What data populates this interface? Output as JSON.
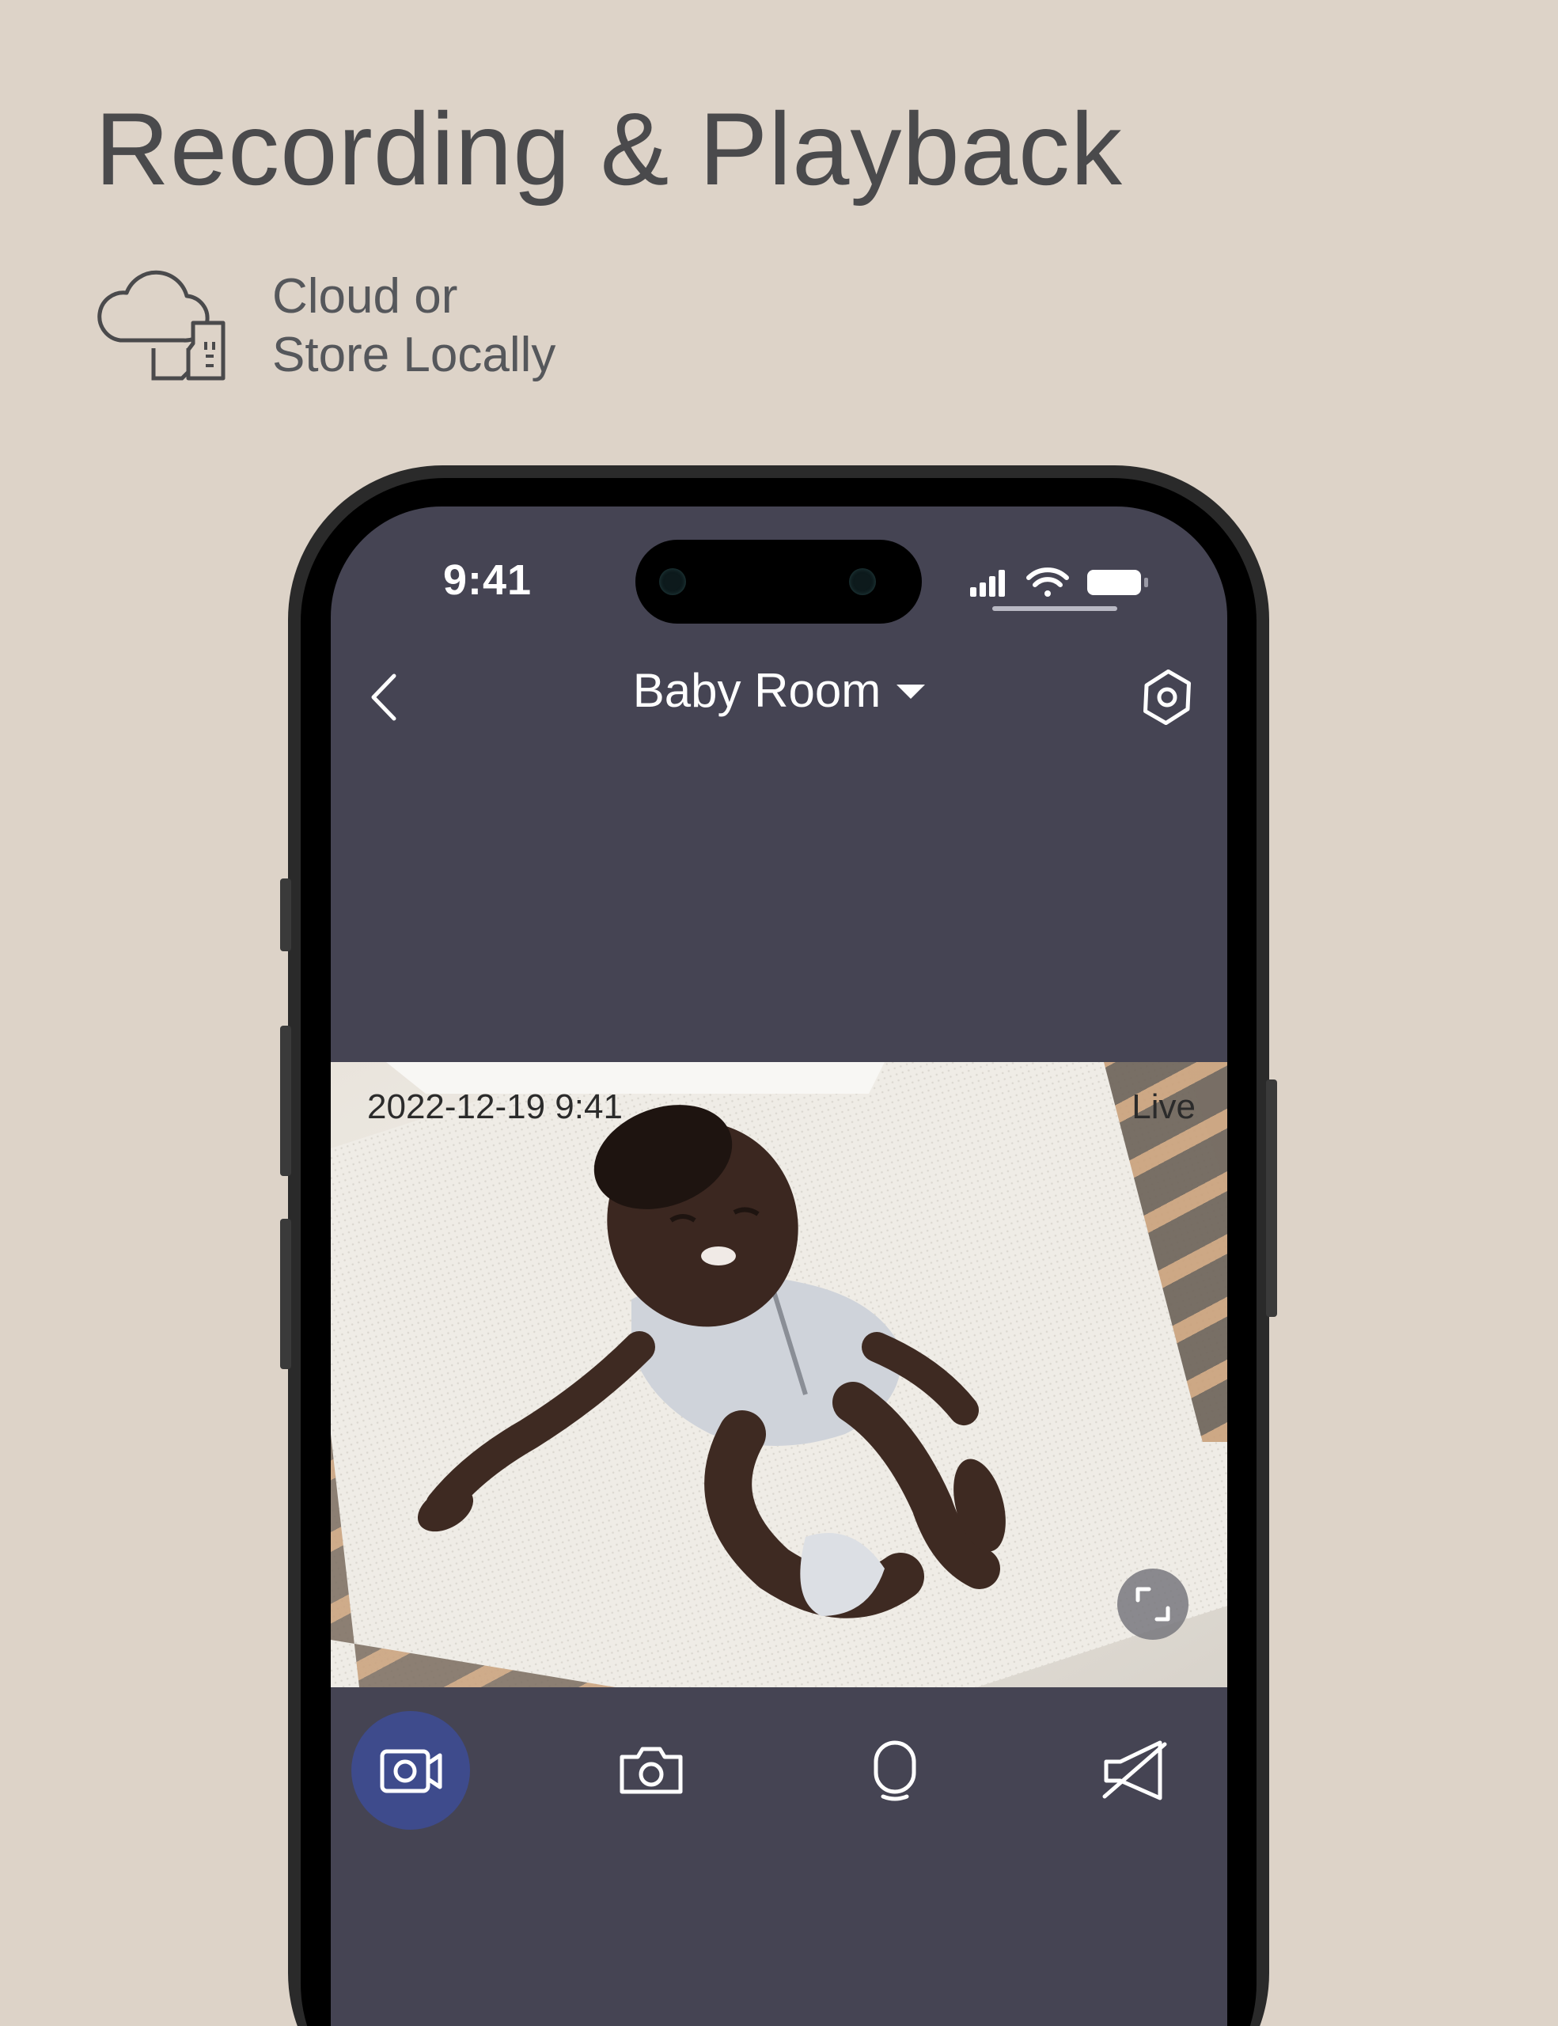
{
  "colors": {
    "background": "#ddd3c8",
    "headline_text": "#4a4a4c",
    "feature_text": "#55575b",
    "screen_bg": "#454453",
    "active_button": "#3e4b8c",
    "icon_white": "#ffffff"
  },
  "headline": "Recording & Playback",
  "feature": {
    "icon": "cloud-storage-icon",
    "line1": "Cloud or",
    "line2": "Store Locally"
  },
  "status_bar": {
    "time": "9:41",
    "icons": [
      "signal-icon",
      "wifi-icon",
      "battery-icon"
    ]
  },
  "nav": {
    "back_icon": "chevron-left-icon",
    "title": "Baby Room",
    "dropdown_icon": "caret-down-icon",
    "settings_icon": "settings-icon"
  },
  "video": {
    "timestamp": "2022-12-19 9:41",
    "status": "Live",
    "fullscreen_icon": "fullscreen-icon"
  },
  "controls": [
    {
      "name": "record-video",
      "icon": "video-record-icon",
      "active": true
    },
    {
      "name": "snapshot",
      "icon": "camera-icon",
      "active": false
    },
    {
      "name": "talk",
      "icon": "microphone-icon",
      "active": false
    },
    {
      "name": "mute",
      "icon": "speaker-muted-icon",
      "active": false
    }
  ]
}
